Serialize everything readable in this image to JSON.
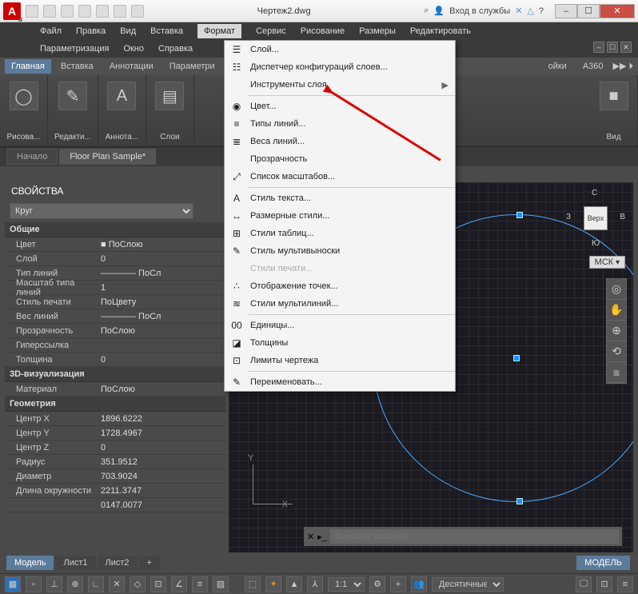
{
  "titlebar": {
    "app_letter": "A",
    "doc_title": "Чертеж2.dwg",
    "search_icon": "⌕",
    "signin": "Вход в службы",
    "min": "–",
    "restore": "☐",
    "close": "✕"
  },
  "menubar": {
    "row1": [
      "Файл",
      "Правка",
      "Вид",
      "Вставка",
      "Формат",
      "Сервис",
      "Рисование",
      "Размеры",
      "Редактировать"
    ],
    "row2": [
      "Параметризация",
      "Окно",
      "Справка"
    ],
    "active": "Формат"
  },
  "ribbon": {
    "tabs": [
      "Главная",
      "Вставка",
      "Аннотации",
      "Параметри",
      "",
      "",
      "",
      "",
      "ойки",
      "A360"
    ],
    "active": "Главная",
    "panels": [
      {
        "icon": "◯",
        "label": "Рисова..."
      },
      {
        "icon": "✎",
        "label": "Редакти..."
      },
      {
        "icon": "A",
        "label": "Аннота..."
      },
      {
        "icon": "▤",
        "label": "Слои"
      },
      {
        "icon": "",
        "label": ""
      },
      {
        "icon": "■",
        "label": "Вид"
      }
    ]
  },
  "filetabs": [
    "Начало",
    "Floor Plan Sample*"
  ],
  "dropdown": [
    {
      "icon": "☰",
      "label": "Слой...",
      "sub": false
    },
    {
      "icon": "☷",
      "label": "Диспетчер конфигураций слоев...",
      "sub": false
    },
    {
      "icon": "",
      "label": "Инструменты слоя",
      "sub": true
    },
    {
      "sep": true
    },
    {
      "icon": "◉",
      "label": "Цвет...",
      "sub": false
    },
    {
      "icon": "≡",
      "label": "Типы линий...",
      "sub": false
    },
    {
      "icon": "≣",
      "label": "Веса линий...",
      "sub": false
    },
    {
      "icon": "",
      "label": "Прозрачность",
      "sub": false
    },
    {
      "icon": "⤢",
      "label": "Список масштабов...",
      "sub": false
    },
    {
      "sep": true
    },
    {
      "icon": "A",
      "label": "Стиль текста...",
      "sub": false
    },
    {
      "icon": "↔",
      "label": "Размерные стили...",
      "sub": false
    },
    {
      "icon": "⊞",
      "label": "Стили таблиц...",
      "sub": false
    },
    {
      "icon": "✎",
      "label": "Стиль мультивыноски",
      "sub": false
    },
    {
      "icon": "",
      "label": "Стили печати...",
      "disabled": true
    },
    {
      "icon": "∴",
      "label": "Отображение точек...",
      "sub": false
    },
    {
      "icon": "≋",
      "label": "Стили мультилиний...",
      "sub": false
    },
    {
      "sep": true
    },
    {
      "icon": "00",
      "label": "Единицы...",
      "sub": false
    },
    {
      "icon": "◪",
      "label": "Толщины",
      "sub": false
    },
    {
      "icon": "⊡",
      "label": "Лимиты чертежа",
      "sub": false
    },
    {
      "sep": true
    },
    {
      "icon": "✎",
      "label": "Переименовать...",
      "sub": false
    }
  ],
  "props": {
    "title": "СВОЙСТВА",
    "object": "Круг",
    "groups": [
      {
        "name": "Общие",
        "rows": [
          {
            "k": "Цвет",
            "v": "■ ПоСлою"
          },
          {
            "k": "Слой",
            "v": "0"
          },
          {
            "k": "Тип линий",
            "v": "———— ПоСл"
          },
          {
            "k": "Масштаб типа линий",
            "v": "1"
          },
          {
            "k": "Стиль печати",
            "v": "ПоЦвету"
          },
          {
            "k": "Вес линий",
            "v": "———— ПоСл"
          },
          {
            "k": "Прозрачность",
            "v": "ПоСлою"
          },
          {
            "k": "Гиперссылка",
            "v": ""
          },
          {
            "k": "Толщина",
            "v": "0"
          }
        ]
      },
      {
        "name": "3D-визуализация",
        "rows": [
          {
            "k": "Материал",
            "v": "ПоСлою"
          }
        ]
      },
      {
        "name": "Геометрия",
        "rows": [
          {
            "k": "Центр X",
            "v": "1896.6222"
          },
          {
            "k": "Центр Y",
            "v": "1728.4967"
          },
          {
            "k": "Центр Z",
            "v": "0"
          },
          {
            "k": "Радиус",
            "v": "351.9512"
          },
          {
            "k": "Диаметр",
            "v": "703.9024"
          },
          {
            "k": "Длина окружности",
            "v": "2211.3747"
          },
          {
            "k": "",
            "v": "0147.0077"
          }
        ]
      }
    ]
  },
  "viewcube": {
    "center": "Верх",
    "n": "С",
    "s": "Ю",
    "e": "В",
    "w": "З",
    "wcs": "МСК"
  },
  "cmd": {
    "placeholder": "Введите команду",
    "x": "✕"
  },
  "bottom_tabs": [
    "Модель",
    "Лист1",
    "Лист2",
    "+"
  ],
  "model_badge": "МОДЕЛЬ",
  "status": {
    "scale": "1:1",
    "units": "Десятичные"
  },
  "ucs": {
    "y": "Y",
    "x": "X"
  }
}
